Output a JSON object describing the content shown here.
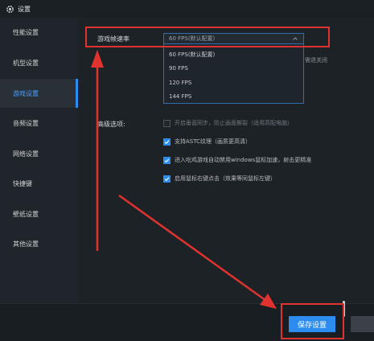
{
  "window": {
    "title": "设置"
  },
  "sidebar": {
    "items": [
      {
        "label": "性能设置"
      },
      {
        "label": "机型设置"
      },
      {
        "label": "游戏设置",
        "active": true
      },
      {
        "label": "音频设置"
      },
      {
        "label": "网络设置"
      },
      {
        "label": "快捷键"
      },
      {
        "label": "壁纸设置"
      },
      {
        "label": "其他设置"
      }
    ]
  },
  "game": {
    "fps_label": "游戏帧速率",
    "fps_selected": "60 FPS(默认配置)",
    "fps_options": [
      "60 FPS(默认配置)",
      "90 FPS",
      "120 FPS",
      "144 FPS"
    ],
    "side_hint": "需退关闭",
    "advanced_label": "高级选项:",
    "advanced_options": [
      {
        "label": "开启垂直同步，防止画面撕裂（适用高配电脑）",
        "checked": false
      },
      {
        "label": "支持ASTC纹理（画质更高清）",
        "checked": true
      },
      {
        "label": "进入吃鸡游戏自动禁用windows鼠标加速，射击更精准",
        "checked": true
      },
      {
        "label": "启用鼠标右键点击（效果等同鼠标左键）",
        "checked": true
      }
    ]
  },
  "footer": {
    "save_label": "保存设置"
  },
  "colors": {
    "accent": "#2d8cf0",
    "annotation": "#e0332f",
    "background": "#1d2227"
  }
}
